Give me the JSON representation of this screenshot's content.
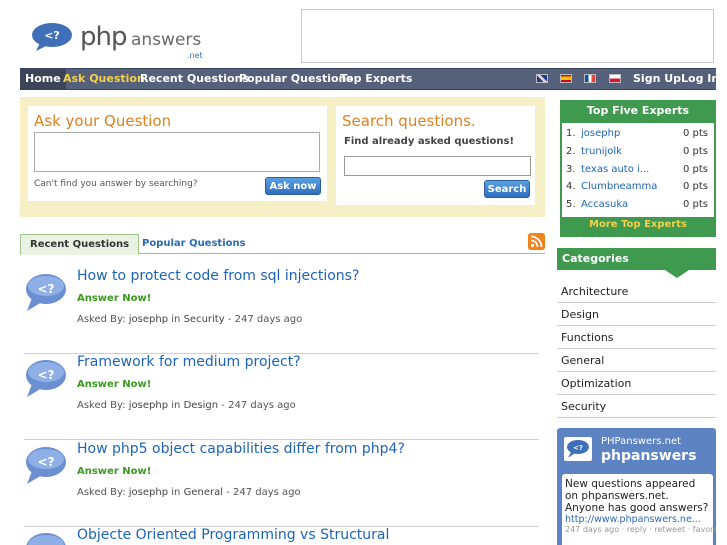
{
  "logo": {
    "php": "php",
    "answers": "answers",
    "net": ".net"
  },
  "nav": {
    "items": [
      {
        "label": "Home"
      },
      {
        "label": "Ask Question"
      },
      {
        "label": "Recent Questions"
      },
      {
        "label": "Popular Questions"
      },
      {
        "label": "Top Experts"
      }
    ],
    "signup": "Sign Up",
    "login": "Log In",
    "flags": [
      "uk-flag",
      "spain-flag",
      "france-flag",
      "poland-flag"
    ]
  },
  "ask": {
    "title": "Ask your Question",
    "hint": "Can't find you answer by searching?",
    "button": "Ask now"
  },
  "search": {
    "title": "Search questions.",
    "subtitle": "Find already asked questions!",
    "button": "Search"
  },
  "tabs": {
    "recent": "Recent Questions",
    "popular": "Popular Questions"
  },
  "questions": [
    {
      "title": "How to protect code from sql injections?",
      "answer": "Answer Now!",
      "asked_by": "Asked By:",
      "user": "josephp",
      "in": "in",
      "category": "Security",
      "age": "- 247 days ago"
    },
    {
      "title": "Framework for medium project?",
      "answer": "Answer Now!",
      "asked_by": "Asked By:",
      "user": "josephp",
      "in": "in",
      "category": "Design",
      "age": "- 247 days ago"
    },
    {
      "title": "How php5 object capabilities differ from php4?",
      "answer": "Answer Now!",
      "asked_by": "Asked By:",
      "user": "josephp",
      "in": "in",
      "category": "General",
      "age": "- 247 days ago"
    },
    {
      "title": "Objecte Oriented Programming vs Structural",
      "answer": "",
      "asked_by": "",
      "user": "",
      "in": "",
      "category": "",
      "age": ""
    }
  ],
  "experts": {
    "title": "Top Five Experts",
    "list": [
      {
        "rank": "1.",
        "name": "josephp",
        "pts": "0 pts"
      },
      {
        "rank": "2.",
        "name": "trunijolk",
        "pts": "0 pts"
      },
      {
        "rank": "3.",
        "name": "texas auto i...",
        "pts": "0 pts"
      },
      {
        "rank": "4.",
        "name": "Clumbneamma",
        "pts": "0 pts"
      },
      {
        "rank": "5.",
        "name": "Accasuka",
        "pts": "0 pts"
      }
    ],
    "more": "More Top Experts"
  },
  "categories": {
    "title": "Categories",
    "items": [
      "Architecture",
      "Design",
      "Functions",
      "General",
      "Optimization",
      "Security"
    ]
  },
  "twitter": {
    "site": "PHPanswers.net",
    "name": "phpanswers",
    "text": "New questions appeared on phpanswers.net. Anyone has good answers?",
    "link": "http://www.phpanswers.ne...",
    "footer": "247 days ago · reply · retweet · favorite"
  },
  "colors": {
    "nav": "#55607a",
    "accent_green": "#3f9a50",
    "link_blue": "#1d64b8",
    "title_orange": "#e0801e",
    "yellow_bg": "#f7efc6"
  }
}
